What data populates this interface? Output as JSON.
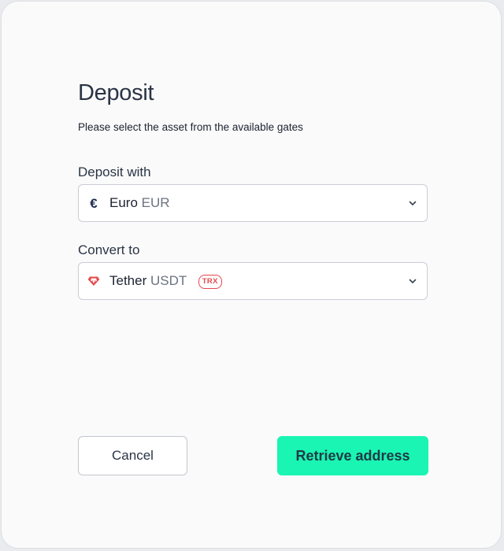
{
  "dialog": {
    "title": "Deposit",
    "subtitle": "Please select the asset from the available gates"
  },
  "deposit_with": {
    "label": "Deposit with",
    "selected": {
      "name": "Euro",
      "code": "EUR",
      "icon": "euro-icon",
      "icon_glyph": "€"
    }
  },
  "convert_to": {
    "label": "Convert to",
    "selected": {
      "name": "Tether",
      "code": "USDT",
      "network": "TRX",
      "icon": "tether-icon"
    }
  },
  "actions": {
    "cancel_label": "Cancel",
    "primary_label": "Retrieve address"
  },
  "colors": {
    "primary_accent": "#1af5b3",
    "badge_red": "#e6484d",
    "title_text": "#2a3445"
  }
}
